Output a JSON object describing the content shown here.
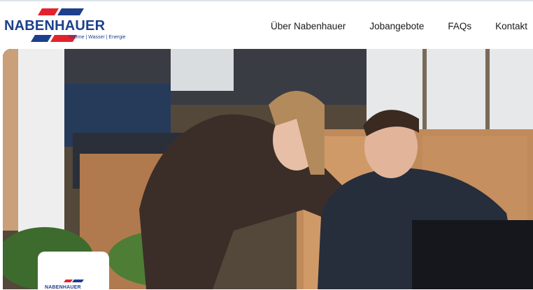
{
  "brand": {
    "name": "NABENHAUER",
    "tagline": "Wärme | Wasser | Energie",
    "colors": {
      "red": "#e3232c",
      "blue": "#1d3f8c"
    }
  },
  "nav": {
    "items": [
      {
        "label": "Über Nabenhauer"
      },
      {
        "label": "Jobangebote"
      },
      {
        "label": "FAQs"
      },
      {
        "label": "Kontakt"
      }
    ]
  },
  "hero": {
    "image": "office-photo-two-colleagues-at-laptop"
  },
  "badge": {
    "name": "NABENHAUER"
  }
}
